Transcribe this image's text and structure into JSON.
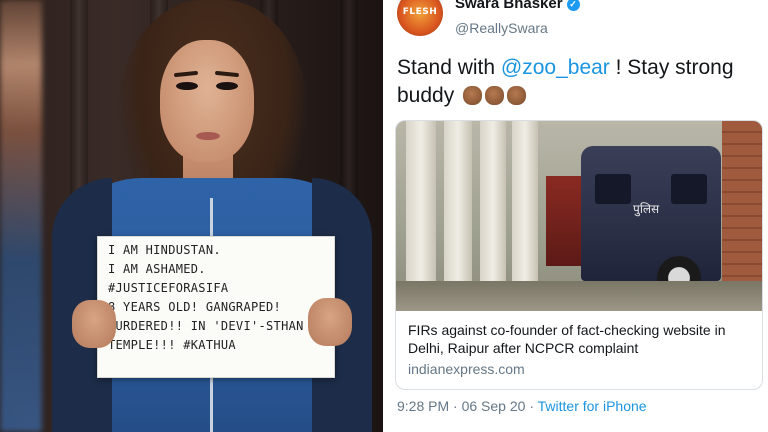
{
  "photo": {
    "sign_lines": [
      "I AM HINDUSTAN.",
      "I AM ASHAMED.",
      "#JUSTICEFORASIFA",
      "8 YEARS OLD! GANGRAPED!",
      "MURDERED!! IN 'DEVI'-STHAN",
      "TEMPLE!!! #KATHUA"
    ]
  },
  "tweet": {
    "avatar_text": "FLESH",
    "name": "Swara Bhasker",
    "verified_glyph": "✓",
    "handle": "@ReallySwara",
    "text_before": "Stand with ",
    "mention": "@zoo_bear",
    "text_after": " ! Stay strong buddy",
    "card": {
      "image_label": "पुलिस",
      "title": "FIRs against co-founder of fact-checking website in Delhi, Raipur after NCPCR complaint",
      "domain": "indianexpress.com"
    },
    "time": "9:28 PM",
    "separator": " · ",
    "date": "06 Sep 20",
    "source": "Twitter for iPhone"
  },
  "colors": {
    "link": "#1b95e0",
    "verified": "#1d9bf0",
    "jacket": "#2f63a8"
  },
  "icons": {
    "verified": "verified-badge-icon",
    "emoji": "fist-emoji-icon"
  }
}
